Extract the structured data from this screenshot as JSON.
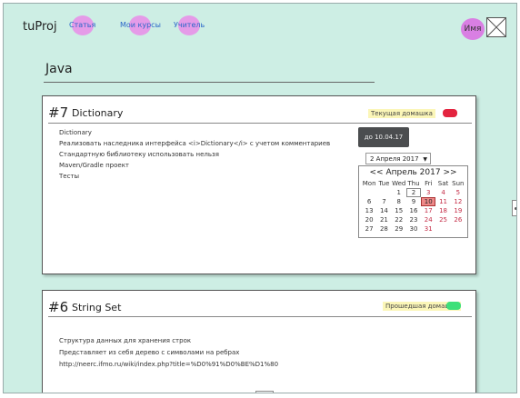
{
  "app": {
    "logo": "tuProj"
  },
  "nav": [
    {
      "label": "Статья"
    },
    {
      "label": "Мои курсы"
    },
    {
      "label": "Учитель"
    }
  ],
  "user": {
    "name": "Имя"
  },
  "course": {
    "title": "Java"
  },
  "cards": [
    {
      "number": "#7",
      "name": "Dictionary",
      "badge": "Текущая домашка",
      "status_color": "#e3243f",
      "description": [
        "Dictionary",
        "Реализовать наследника интерфейса <i>Dictionary</i> с учетом комментариев",
        "Стандартную библиотеку использовать нельзя",
        "Maven/Gradle проект",
        "Тесты"
      ],
      "deadline_button": "до 10.04.17",
      "date_select": "2 Апреля 2017",
      "calendar": {
        "prev": "<<",
        "month": "Апрель 2017",
        "next": ">>",
        "weekdays": [
          "Mon",
          "Tue",
          "Wed",
          "Thu",
          "Fri",
          "Sat",
          "Sun"
        ],
        "weeks": [
          [
            "",
            "",
            "1",
            "2",
            "3",
            "4",
            "5"
          ],
          [
            "6",
            "7",
            "8",
            "9",
            "10",
            "11",
            "12"
          ],
          [
            "13",
            "14",
            "15",
            "16",
            "17",
            "18",
            "19"
          ],
          [
            "20",
            "21",
            "22",
            "23",
            "24",
            "25",
            "26"
          ],
          [
            "27",
            "28",
            "29",
            "30",
            "31",
            "",
            ""
          ]
        ]
      }
    },
    {
      "number": "#6",
      "name": "String Set",
      "badge": "Прошедшая домашка",
      "status_color": "#3de07a",
      "description": [
        "Структура данных для хранения строк",
        "Представляет из себя дерево с символами на ребрах",
        "http://neerc.ifmo.ru/wiki/index.php?title=%D0%91%D0%BE%D1%80"
      ]
    }
  ]
}
